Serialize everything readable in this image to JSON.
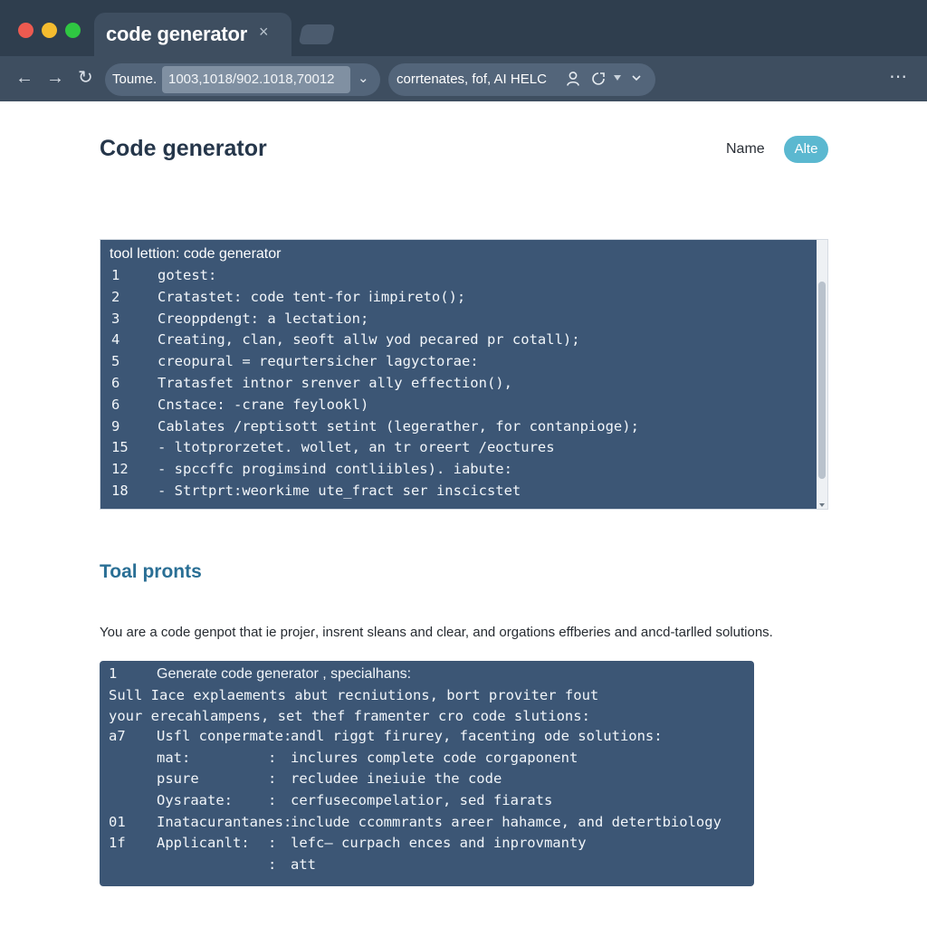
{
  "browser": {
    "tab": {
      "title": "code generator",
      "close": "×"
    },
    "nav": {
      "back": "←",
      "forward": "→",
      "reload": "↻"
    },
    "address": {
      "label": "Toume.",
      "value": "1003,1018/902.1018,70012",
      "chevron": "⌄"
    },
    "search": {
      "text": "corrtenates, fof, AI HELC"
    },
    "menu": "⋯"
  },
  "page": {
    "title": "Code generator",
    "name_label": "Name",
    "toggle_label": "Alte"
  },
  "code_panel": {
    "header": "tool lettion: code generator",
    "lines": [
      {
        "num": "1",
        "text": "gotest:"
      },
      {
        "num": "2",
        "text": "Cratastet: code tent-for ⅰimpireto();"
      },
      {
        "num": "3",
        "text": "Creoppdengt:  a lectation;"
      },
      {
        "num": "4",
        "text": "Creating, clan, seoft allw yod pecared pr cotall);"
      },
      {
        "num": "5",
        "text": "creopural = requrtersicher lagyctorae:"
      },
      {
        "num": "6",
        "text": "Tratasfet intnor srenver ally effection(),"
      },
      {
        "num": "6",
        "text": "Cnstace: -crane feylookl)"
      },
      {
        "num": "9",
        "text": "Cablates /reptisott setint (legerather, for contanpioge);"
      },
      {
        "num": "15",
        "text": "- ltotprorzetet. wollet, an tr oreert /eoctures"
      },
      {
        "num": "12",
        "text": "- spccffc progimsind contliibles). iabute:"
      },
      {
        "num": "18",
        "text": "- Strtprt:weorkime ute_fract ser inscicstet"
      }
    ]
  },
  "section": {
    "title": "Toal pronts",
    "description": "You are a code genpot that ie projeɾ, insrent sleans and clear, and orgations effberies and ancd-tarlled solutions."
  },
  "prompt_panel": {
    "header": {
      "num": "1",
      "text": "Generate code generator ,  specialhans:"
    },
    "intro": [
      "Sull Iace explaements abut recniutions, bort proviter fout",
      "your erecahlampens, set thef framenter cro code slutions:"
    ],
    "rows": [
      {
        "num": "a7",
        "key": "Usfl conpermate:",
        "colon": "",
        "value": "andl riggt firurey, facenting ode solutions:"
      },
      {
        "num": "",
        "key": "mat:",
        "colon": ":",
        "value": "inclures complete code corgaponent"
      },
      {
        "num": "",
        "key": "psure",
        "colon": ":",
        "value": "recludee ineiuie the code"
      },
      {
        "num": "",
        "key": "Oysraate:",
        "colon": ":",
        "value": "cerfusecompelatior, sed fiarats"
      },
      {
        "num": "01",
        "key": "Inatacurantanes:",
        "colon": "",
        "value": "include ccommrants areer hahamce, and detertbiology"
      },
      {
        "num": "1f",
        "key": "Applicanlt:",
        "colon": ":",
        "value": "lefc— curpach ences and inprovmanty"
      },
      {
        "num": "",
        "key": "",
        "colon": ":",
        "value": "att"
      }
    ]
  }
}
